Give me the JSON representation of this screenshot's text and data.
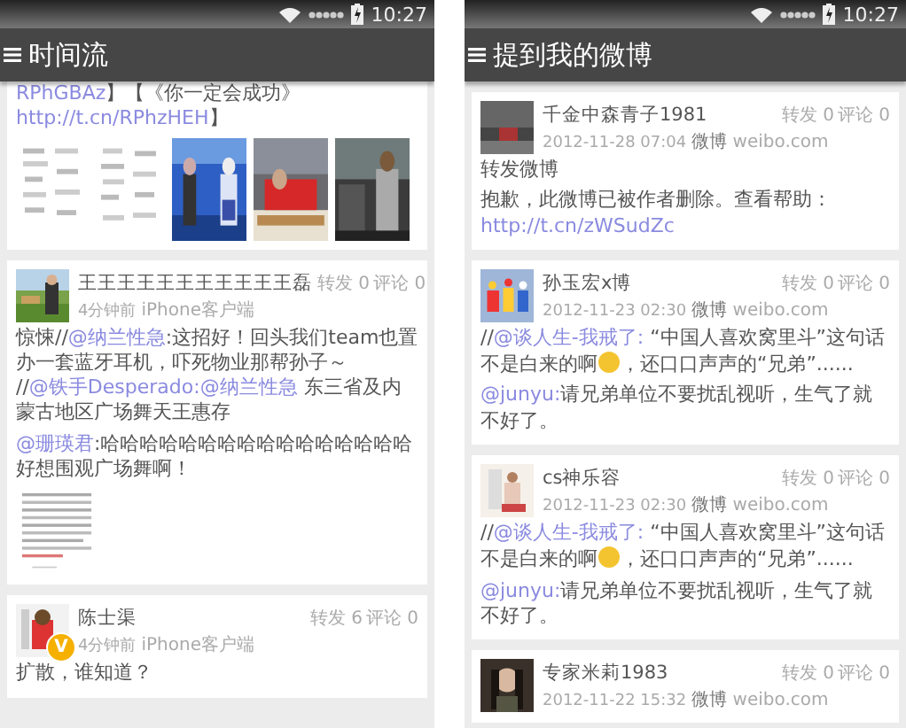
{
  "screens": [
    {
      "status_time": "10:27",
      "title": "时间流",
      "posts": [
        {
          "paragraphs": [
            [
              {
                "kind": "link",
                "text": "RPhGBAz"
              },
              {
                "kind": "text",
                "text": "】【《你一定会成功》"
              },
              {
                "kind": "link",
                "text": "http://t.cn/"
              },
              {
                "kind": "link",
                "text": "RPhzHEH"
              },
              {
                "kind": "text",
                "text": "】"
              }
            ]
          ],
          "media": [
            {
              "kind": "picture"
            },
            {
              "kind": "picture"
            },
            {
              "kind": "picture"
            },
            {
              "kind": "picture"
            },
            {
              "kind": "picture"
            }
          ]
        },
        {
          "author": "王王王王王王王王王王王磊",
          "time": "4分钟前",
          "source": "iPhone客户端",
          "reposts": "转发 0",
          "comments": "评论 0",
          "paragraphs": [
            [
              {
                "kind": "text",
                "text": "惊悚//"
              },
              {
                "kind": "link",
                "text": "@纳兰性急"
              },
              {
                "kind": "text",
                "text": ":这招好！回头我们team也置办一套蓝牙耳机，吓死物业那帮孙子～ //"
              },
              {
                "kind": "link",
                "text": "@铁手Desperado:"
              },
              {
                "kind": "link",
                "text": "@纳兰性急"
              },
              {
                "kind": "text",
                "text": " 东三省及内蒙古地区广场舞天王惠存"
              }
            ],
            [
              {
                "kind": "link",
                "text": "@珊瑛君"
              },
              {
                "kind": "text",
                "text": ":哈哈哈哈哈哈哈哈哈哈哈哈哈哈哈哈好想围观广场舞啊！"
              }
            ]
          ],
          "media": [
            {
              "kind": "document"
            }
          ]
        },
        {
          "author": "陈士渠",
          "badge": "V",
          "time": "4分钟前",
          "source": "iPhone客户端",
          "reposts": "转发 6",
          "comments": "评论 0",
          "paragraphs": [
            [
              {
                "kind": "text",
                "text": "扩散，谁知道？"
              }
            ]
          ]
        }
      ]
    },
    {
      "status_time": "10:27",
      "title": "提到我的微博",
      "posts": [
        {
          "author": "千金中森青子1981",
          "time": "2012-11-28 07:04",
          "source": "**微博** weibo.com",
          "reposts": "转发 0",
          "comments": "评论 0",
          "paragraphs": [
            [
              {
                "kind": "text",
                "text": "转发微博"
              }
            ],
            [
              {
                "kind": "text",
                "text": "抱歉，此微博已被作者删除。查看帮助："
              },
              {
                "kind": "link",
                "text": "http://t.cn/zWSudZc"
              }
            ]
          ]
        },
        {
          "author": "孙玉宏x博",
          "time": "2012-11-23 02:30",
          "source": "**微博** weibo.com",
          "reposts": "转发 0",
          "comments": "评论 0",
          "paragraphs": [
            [
              {
                "kind": "text",
                "text": "//"
              },
              {
                "kind": "link",
                "text": "@谈人生-我戒了:"
              },
              {
                "kind": "text",
                "text": " “中国人喜欢窝里斗”这句话不是白来的啊"
              },
              {
                "kind": "emoji"
              },
              {
                "kind": "text",
                "text": "，还口口声声的“兄弟”......"
              }
            ],
            [
              {
                "kind": "link",
                "text": "@junyu:"
              },
              {
                "kind": "text",
                "text": "请兄弟单位不要扰乱视听，生气了就不好了。"
              }
            ]
          ]
        },
        {
          "author": "cs神乐容",
          "time": "2012-11-23 02:30",
          "source": "**微博** weibo.com",
          "reposts": "转发 0",
          "comments": "评论 0",
          "paragraphs": [
            [
              {
                "kind": "text",
                "text": "//"
              },
              {
                "kind": "link",
                "text": "@谈人生-我戒了:"
              },
              {
                "kind": "text",
                "text": " “中国人喜欢窝里斗”这句话不是白来的啊"
              },
              {
                "kind": "emoji"
              },
              {
                "kind": "text",
                "text": "，还口口声声的“兄弟”......"
              }
            ],
            [
              {
                "kind": "link",
                "text": "@junyu:"
              },
              {
                "kind": "text",
                "text": "请兄弟单位不要扰乱视听，生气了就不好了。"
              }
            ]
          ]
        },
        {
          "author": "专家米莉1983",
          "time": "2012-11-22 15:32",
          "source": "**微博** weibo.com",
          "reposts": "转发 0",
          "comments": "评论 0"
        }
      ]
    }
  ]
}
